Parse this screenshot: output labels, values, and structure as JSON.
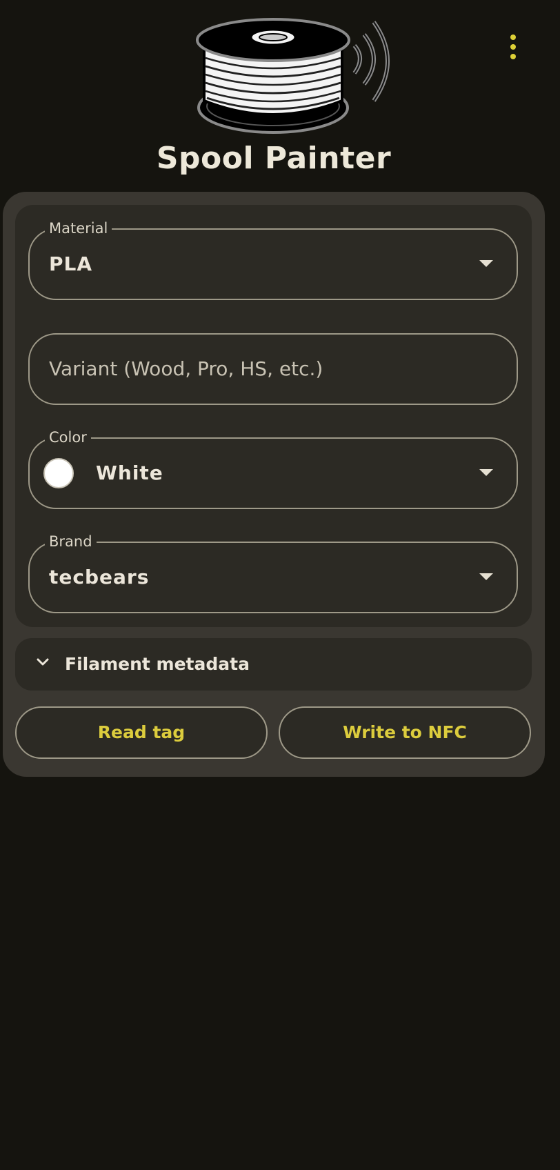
{
  "app": {
    "title": "Spool Painter"
  },
  "icons": {
    "menu": "more-vert-icon",
    "logo": "nfc-spool-logo",
    "dropdown": "arrow-drop-down-icon",
    "expand": "chevron-down-icon"
  },
  "form": {
    "material": {
      "label": "Material",
      "value": "PLA"
    },
    "variant": {
      "placeholder": "Variant (Wood, Pro, HS, etc.)",
      "value": ""
    },
    "color": {
      "label": "Color",
      "value": "White",
      "swatch_hex": "#ffffff"
    },
    "brand": {
      "label": "Brand",
      "value": "tecbears"
    }
  },
  "metadata": {
    "label": "Filament metadata",
    "expanded": false
  },
  "actions": {
    "read_label": "Read tag",
    "write_label": "Write to NFC"
  },
  "colors": {
    "background": "#15140f",
    "card": "#3a3731",
    "panel": "#2c2a24",
    "accent": "#ddd037",
    "text": "#ece6da",
    "outline": "#9e9988"
  }
}
